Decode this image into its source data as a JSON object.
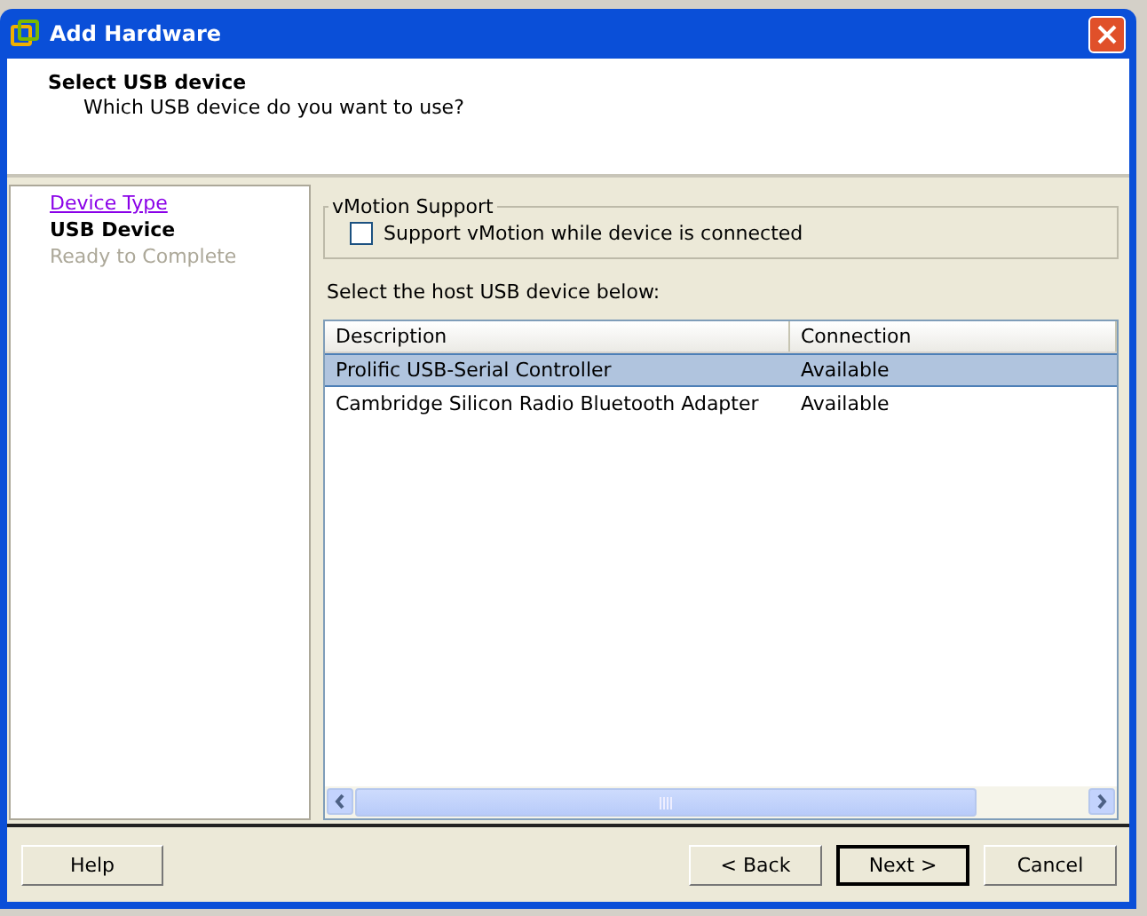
{
  "window": {
    "title": "Add Hardware"
  },
  "header": {
    "title": "Select USB device",
    "subtitle": "Which USB device do you want to use?"
  },
  "steps": [
    {
      "label": "Device Type",
      "kind": "link"
    },
    {
      "label": "USB Device",
      "kind": "current"
    },
    {
      "label": "Ready to Complete",
      "kind": "pending"
    }
  ],
  "vmotion": {
    "legend": "vMotion Support",
    "label": "Support vMotion while device is connected",
    "checked": false
  },
  "table": {
    "caption": "Select the host USB device below:",
    "columns": [
      "Description",
      "Connection"
    ],
    "rows": [
      {
        "description": "Prolific USB-Serial Controller",
        "connection": "Available",
        "selected": true
      },
      {
        "description": "Cambridge Silicon Radio Bluetooth Adapter",
        "connection": "Available",
        "selected": false
      }
    ]
  },
  "buttons": [
    {
      "label": "Help",
      "kind": "help",
      "default": false
    },
    {
      "label": "< Back",
      "kind": "nav",
      "default": false
    },
    {
      "label": "Next >",
      "kind": "nav",
      "default": true
    },
    {
      "label": "Cancel",
      "kind": "nav",
      "default": false
    }
  ]
}
